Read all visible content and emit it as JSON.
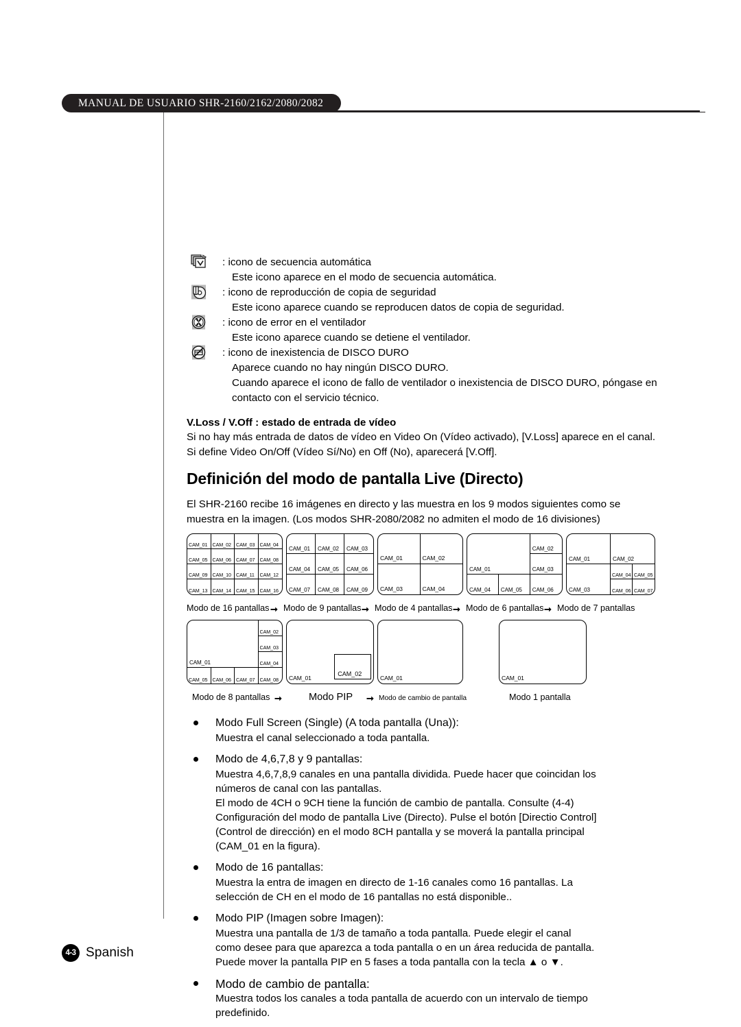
{
  "header": {
    "title": "MANUAL DE USUARIO SHR-2160/2162/2080/2082"
  },
  "footer": {
    "page_number": "4-3",
    "language": "Spanish"
  },
  "icon_list": [
    {
      "icon": "auto-sequence-icon",
      "label": ": icono de secuencia automática",
      "description": "Este icono aparece en el modo de secuencia automática."
    },
    {
      "icon": "backup-playback-icon",
      "label": ": icono de reproducción de copia de seguridad",
      "description": "Este icono aparece cuando se reproducen datos de copia de seguridad."
    },
    {
      "icon": "fan-error-icon",
      "label": ": icono de error en el ventilador",
      "description": "Este icono aparece cuando se detiene el ventilador."
    },
    {
      "icon": "no-hdd-icon",
      "label": ": icono de inexistencia de DISCO DURO",
      "description": "Aparece cuando no hay ningún DISCO DURO.",
      "description2": "Cuando aparece el icono de fallo de ventilador o inexistencia de DISCO DURO, póngase en",
      "description3": "contacto con el servicio técnico."
    }
  ],
  "vloss": {
    "heading": "V.Loss / V.Off : estado de entrada de vídeo",
    "line1": "Si no hay más entrada de datos de vídeo en Video On (Vídeo activado), [V.Loss] aparece en el canal.",
    "line2": "Si define Video On/Off (Vídeo Sí/No) en Off (No), aparecerá [V.Off]."
  },
  "section": {
    "title": "Definición del modo de pantalla Live (Directo)",
    "intro_line1": "El SHR-2160 recibe 16 imágenes en directo y las muestra en los 9 modos siguientes como se",
    "intro_line2": "muestra en la imagen. (Los modos SHR-2080/2082 no admiten el modo de 16 divisiones)"
  },
  "diagrams": {
    "row1": {
      "grid16": {
        "caption": "Modo de 16 pantallas",
        "cells": [
          "CAM_01",
          "CAM_02",
          "CAM_03",
          "CAM_04",
          "CAM_05",
          "CAM_06",
          "CAM_07",
          "CAM_08",
          "CAM_09",
          "CAM_10",
          "CAM_11",
          "CAM_12",
          "CAM_13",
          "CAM_14",
          "CAM_15",
          "CAM_16"
        ]
      },
      "grid9": {
        "caption": "Modo de 9 pantallas",
        "cells": [
          "CAM_01",
          "CAM_02",
          "CAM_03",
          "CAM_04",
          "CAM_05",
          "CAM_06",
          "CAM_07",
          "CAM_08",
          "CAM_09"
        ]
      },
      "grid4": {
        "caption": "Modo de 4 pantallas",
        "cells": [
          "CAM_01",
          "CAM_02",
          "CAM_03",
          "CAM_04"
        ]
      },
      "grid6": {
        "caption": "Modo de 6 pantallas",
        "cells": [
          "CAM_01",
          "CAM_02",
          "CAM_03",
          "CAM_04",
          "CAM_05",
          "CAM_06"
        ]
      },
      "grid7": {
        "caption": "Modo de 7 pantallas",
        "cells": [
          "CAM_01",
          "CAM_02",
          "CAM_03",
          "CAM_04",
          "CAM_05",
          "CAM_06",
          "CAM_07"
        ]
      },
      "arrow": "➞"
    },
    "row2": {
      "grid8": {
        "caption": "Modo de 8 pantallas",
        "cells": [
          "CAM_01",
          "CAM_02",
          "CAM_03",
          "CAM_04",
          "CAM_05",
          "CAM_06",
          "CAM_07",
          "CAM_08"
        ]
      },
      "pip": {
        "caption": "Modo PIP",
        "main": "CAM_01",
        "inset": "CAM_02"
      },
      "switch": {
        "caption": "Modo de cambio de pantalla",
        "cells": [
          "CAM_01"
        ]
      },
      "single": {
        "caption": "Modo 1 pantalla",
        "cells": [
          "CAM_01"
        ]
      },
      "arrow": "➞"
    }
  },
  "bullets": [
    {
      "title": "Modo Full Screen (Single) (A toda pantalla (Una)):",
      "lines": [
        "Muestra el canal seleccionado a toda pantalla."
      ]
    },
    {
      "title": "Modo de 4,6,7,8 y 9 pantallas:",
      "lines": [
        "Muestra 4,6,7,8,9 canales en una pantalla dividida. Puede hacer que coincidan los",
        "números de canal con las pantallas.",
        "El modo de 4CH o 9CH tiene la función de cambio de pantalla. Consulte (4-4)",
        "Configuración del modo de pantalla Live (Directo). Pulse el botón [Directio Control]",
        "(Control de dirección) en el modo 8CH pantalla y se moverá la pantalla principal",
        "(CAM_01 en la figura)."
      ]
    },
    {
      "title": "Modo de 16 pantallas:",
      "lines": [
        "Muestra la entra de imagen en directo de 1-16 canales como 16 pantallas. La",
        "selección de CH en el modo de 16 pantallas no está disponible.."
      ]
    },
    {
      "title": "Modo PIP (Imagen sobre Imagen):",
      "lines": [
        "Muestra una pantalla de 1/3 de tamaño a toda pantalla. Puede elegir el canal",
        "como desee para que aparezca a toda pantalla o en un área reducida de pantalla.",
        "Puede mover la pantalla PIP en 5 fases a toda pantalla con la tecla ▲ o ▼."
      ]
    },
    {
      "title": "Modo de cambio de pantalla:",
      "big": true,
      "lines": [
        "Muestra todos los canales a toda pantalla de acuerdo con un intervalo de tiempo",
        "predefinido."
      ]
    }
  ]
}
